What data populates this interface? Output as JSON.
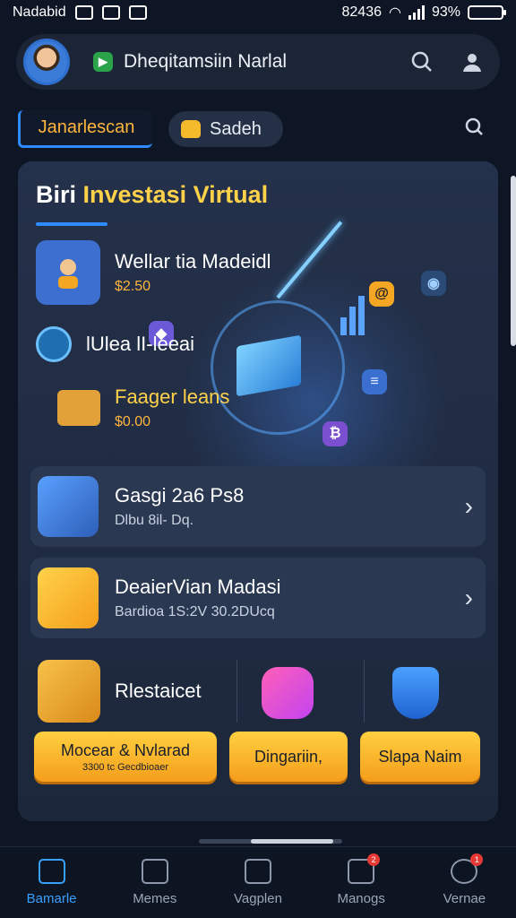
{
  "status_bar": {
    "carrier": "Nadabid",
    "indicators": "82436",
    "battery": "93%",
    "battery_level": 0.93
  },
  "header": {
    "title": "Dheqitamsiin Narlal",
    "icons": [
      "avatar",
      "app-logo-icon",
      "search-icon",
      "profile-icon"
    ]
  },
  "tabs": {
    "active": "Janarlescan",
    "search_label": "Sadeh",
    "icons": [
      "lock-icon",
      "settings-icon"
    ]
  },
  "card": {
    "title_prefix": "Biri",
    "title_highlight": "Investasi Virtual",
    "features": [
      {
        "name": "Wellar tia Madeidl",
        "price": "$2.50"
      },
      {
        "name": "lUlea lI-leeai",
        "price": ""
      },
      {
        "name": "Faager leans",
        "price": "$0.00"
      }
    ],
    "rows": [
      {
        "title": "Gasgi 2a6 Ps8",
        "subtitle": "Dlbu 8il- Dq.",
        "icon": "megaphone-icon"
      },
      {
        "title": "DeaierVian Madasi",
        "subtitle": "Bardioa 1S:2V 30.2DUcq",
        "icon": "crate-icon"
      }
    ],
    "row3_label": "Rlestaicet",
    "row3_icons": [
      "box-icon",
      "star-chat-icon",
      "shield-icon"
    ],
    "buttons": [
      {
        "label": "Mocear & Nvlarad",
        "sub": "3300   tc Gecdbioaer"
      },
      {
        "label": "Dingariin,",
        "sub": ""
      },
      {
        "label": "Slapa Naim",
        "sub": ""
      }
    ]
  },
  "bottom_nav": [
    {
      "label": "Bamarle",
      "icon": "home-icon",
      "active": true,
      "badge": ""
    },
    {
      "label": "Memes",
      "icon": "bank-icon",
      "active": false,
      "badge": ""
    },
    {
      "label": "Vagplen",
      "icon": "mail-icon",
      "active": false,
      "badge": ""
    },
    {
      "label": "Manogs",
      "icon": "chat-icon",
      "active": false,
      "badge": "2"
    },
    {
      "label": "Vernae",
      "icon": "search-icon",
      "active": false,
      "badge": "1"
    }
  ],
  "colors": {
    "accent": "#2d8bff",
    "highlight": "#ffd24a",
    "cta": "#f5a623",
    "badge": "#e53935"
  }
}
